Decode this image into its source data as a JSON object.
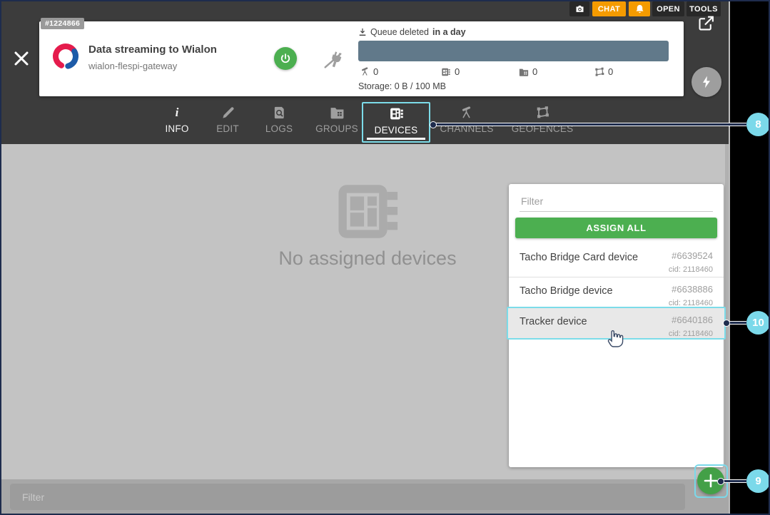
{
  "topbar": {
    "chat_label": "CHAT",
    "open_label": "OPEN",
    "tools_label": "TOOLS"
  },
  "stream_card": {
    "id_badge": "#1224866",
    "title": "Data streaming to Wialon",
    "subtitle": "wialon-flespi-gateway",
    "queue_text": "Queue deleted",
    "queue_text_bold": "in a day",
    "counters": [
      {
        "icon": "channels-icon",
        "value": "0"
      },
      {
        "icon": "devices-icon",
        "value": "0"
      },
      {
        "icon": "groups-icon",
        "value": "0"
      },
      {
        "icon": "geofences-icon",
        "value": "0"
      }
    ],
    "storage_text": "Storage: 0 B / 100 MB"
  },
  "tabs": [
    {
      "label": "INFO"
    },
    {
      "label": "EDIT"
    },
    {
      "label": "LOGS"
    },
    {
      "label": "GROUPS"
    },
    {
      "label": "DEVICES",
      "active": true
    },
    {
      "label": "CHANNELS"
    },
    {
      "label": "GEOFENCES"
    }
  ],
  "main": {
    "empty_state": "No assigned devices"
  },
  "device_panel": {
    "filter_placeholder": "Filter",
    "assign_all_label": "ASSIGN ALL",
    "devices": [
      {
        "name": "Tacho Bridge Card device",
        "id": "#6639524",
        "cid": "cid: 2118460",
        "highlighted": false
      },
      {
        "name": "Tacho Bridge device",
        "id": "#6638886",
        "cid": "cid: 2118460",
        "highlighted": false
      },
      {
        "name": "Tracker device",
        "id": "#6640186",
        "cid": "cid: 2118460",
        "highlighted": true
      }
    ]
  },
  "bottom_bar": {
    "filter_placeholder": "Filter"
  },
  "annotations": {
    "devices_tab": "8",
    "add_button": "9",
    "tracker_row": "10"
  },
  "icons": {
    "info_glyph": "i"
  },
  "colors": {
    "accent_green": "#4caf50",
    "fab_green": "#43a047",
    "annotation_cyan": "#7bd9ea",
    "brand_orange": "#f59b00",
    "queue_bar": "#61798a",
    "frame_navy": "#1e2c4d"
  }
}
